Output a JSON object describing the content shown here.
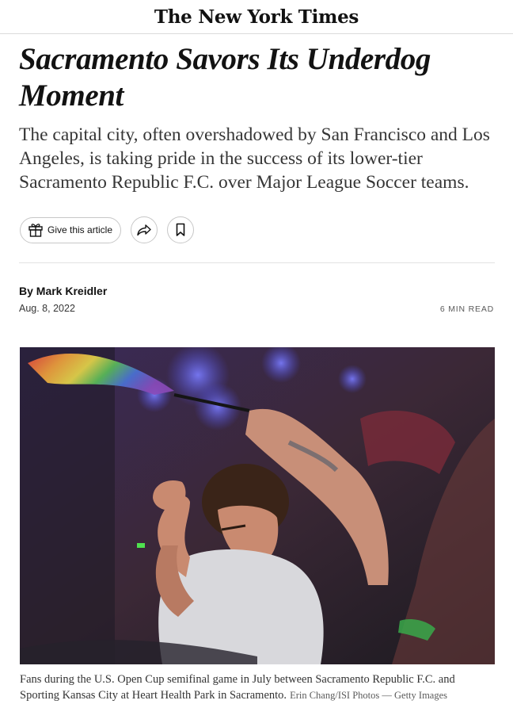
{
  "masthead": {
    "logo_text": "The New York Times"
  },
  "article": {
    "headline_line1": "Sacramento Savors Its Underdog",
    "headline_line2": "Moment",
    "summary": "The capital city, often overshadowed by San Francisco and Los Angeles, is taking pride in the success of its lower-tier Sacramento Republic F.C. over Major League Soccer teams.",
    "byline": "By Mark Kreidler",
    "date": "Aug. 8, 2022",
    "read_time": "6 MIN READ"
  },
  "actions": {
    "gift_label": "Give this article",
    "gift_icon": "gift-icon",
    "share_icon": "share-icon",
    "save_icon": "bookmark-icon"
  },
  "photo": {
    "caption": "Fans during the U.S. Open Cup semifinal game in July between Sacramento Republic F.C. and Sporting Kansas City at Heart Health Park in Sacramento.",
    "credit": "Erin Chang/ISI Photos — Getty Images"
  },
  "colors": {
    "text": "#121212",
    "summary": "#363636",
    "border": "#c7c7c7"
  }
}
